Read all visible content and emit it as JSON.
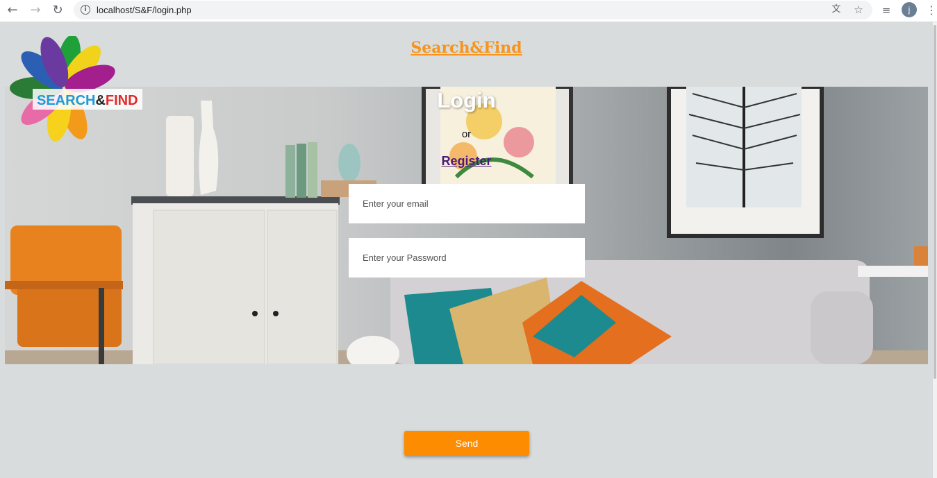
{
  "browser": {
    "url": "localhost/S&F/login.php",
    "avatar_initial": "j",
    "nav_icons": [
      "back-arrow-icon",
      "forward-arrow-icon",
      "reload-icon"
    ],
    "omnibox_icons": [
      "info-icon",
      "translate-icon",
      "star-icon"
    ]
  },
  "page": {
    "site_title": "Search&Find",
    "logo_text": "SEARCH&FIND",
    "login_title": "Login",
    "or_text": "or",
    "register_link": "Register",
    "email_placeholder": "Enter your email",
    "password_placeholder": "Enter your Password",
    "send_label": "Send"
  },
  "colors": {
    "accent": "#fd8c00",
    "title": "#f7941d",
    "link": "#4b1c7a",
    "background": "#d8dcdc"
  }
}
